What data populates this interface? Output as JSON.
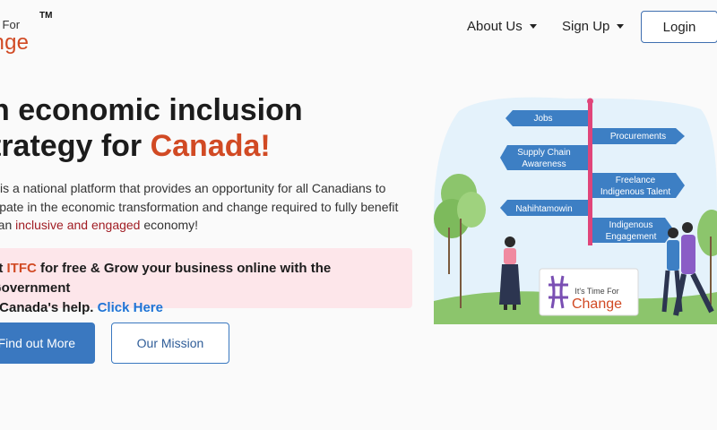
{
  "header": {
    "logo": {
      "top": "ime For",
      "bottom": "ange",
      "tm": "TM"
    },
    "nav": {
      "about": "About Us",
      "signup": "Sign Up",
      "login": "Login"
    }
  },
  "hero": {
    "title_line1": "n economic inclusion",
    "title_line2_plain": "trategy for ",
    "title_line2_accent": "Canada!",
    "desc_line1": "C is a national platform that provides an opportunity for all Canadians to",
    "desc_line2": "icipate in the economic transformation and change required to fully benefit",
    "desc_line3_pre": "n an ",
    "desc_line3_hl": "inclusive and engaged",
    "desc_line3_post": " economy!",
    "promo_line1_pre": "et ",
    "promo_line1_hl": "ITFC",
    "promo_line1_post": " for free & Grow your business online with the Government",
    "promo_line2_pre": "f Canada's help. ",
    "promo_line2_link": "Click Here",
    "btn_find": "Find out More",
    "btn_mission": "Our Mission"
  },
  "illustration": {
    "signs": {
      "jobs": "Jobs",
      "procurements": "Procurements",
      "supply_1": "Supply Chain",
      "supply_2": "Awareness",
      "freelance_1": "Freelance",
      "freelance_2": "Indigenous Talent",
      "nahihtamowin": "Nahihtamowin",
      "indigenous_1": "Indigenous",
      "indigenous_2": "Engagement"
    },
    "board": {
      "top": "It's Time For",
      "bottom": "Change"
    }
  },
  "colors": {
    "accent": "#d14a24",
    "primary": "#3a78c0",
    "link": "#1f74d6",
    "promo_bg": "#fde6ea",
    "sign": "#3d7fc4"
  }
}
